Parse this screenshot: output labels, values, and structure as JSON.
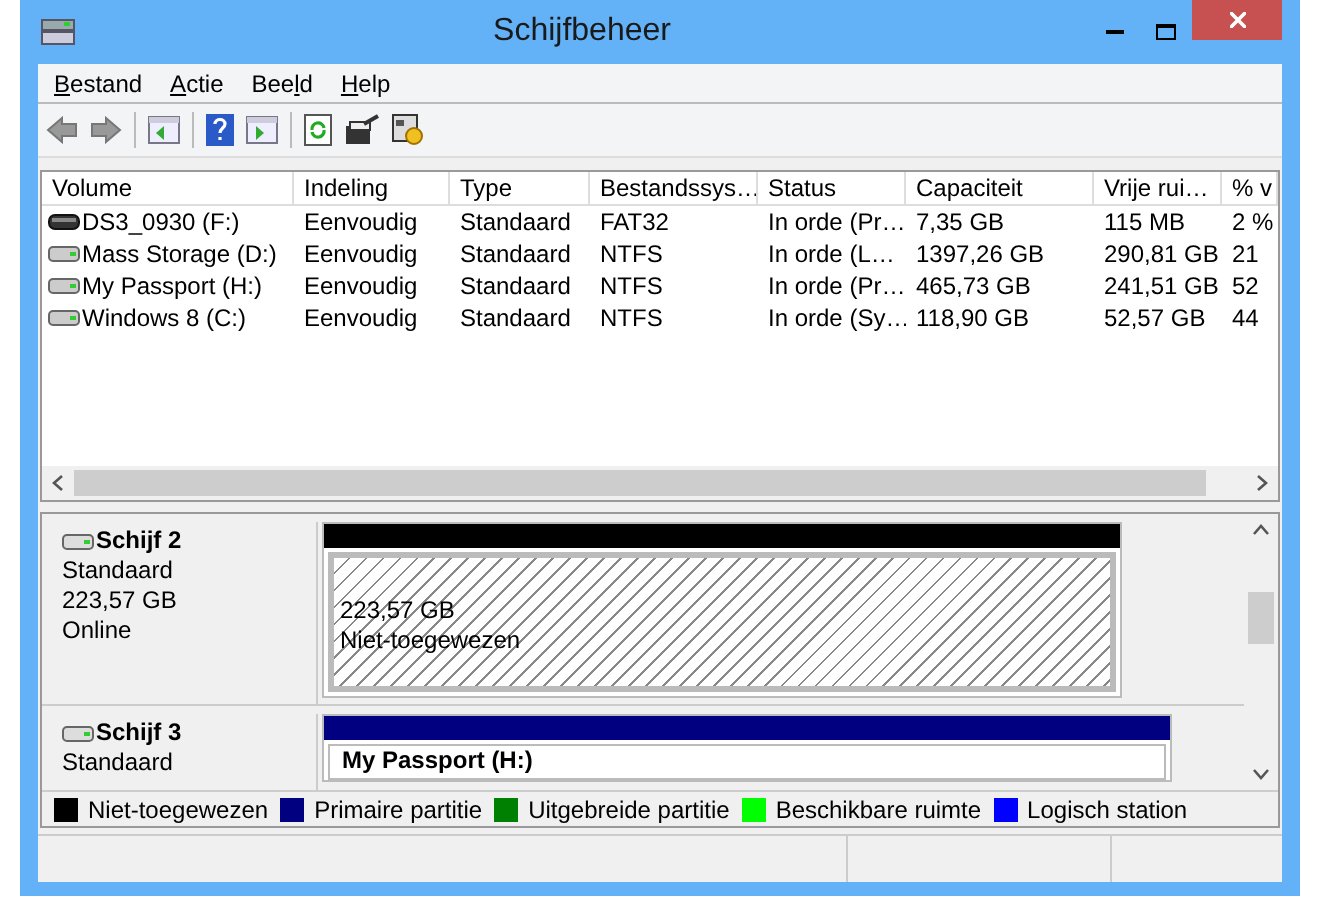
{
  "window": {
    "title": "Schijfbeheer"
  },
  "menu": [
    {
      "key": "B",
      "rest": "estand"
    },
    {
      "key": "A",
      "rest": "ctie"
    },
    {
      "lead": "Bee",
      "key": "l",
      "rest": "d"
    },
    {
      "key": "H",
      "rest": "elp"
    }
  ],
  "table": {
    "columns": [
      "Volume",
      "Indeling",
      "Type",
      "Bestandssys…",
      "Status",
      "Capaciteit",
      "Vrije rui…",
      "% v"
    ],
    "rows": [
      {
        "kind": "removable",
        "cells": [
          "DS3_0930 (F:)",
          "Eenvoudig",
          "Standaard",
          "FAT32",
          "In orde (Pr…",
          "7,35 GB",
          "115 MB",
          "2 %"
        ]
      },
      {
        "kind": "disk",
        "cells": [
          "Mass Storage (D:)",
          "Eenvoudig",
          "Standaard",
          "NTFS",
          "In orde (L…",
          "1397,26 GB",
          "290,81 GB",
          "21"
        ]
      },
      {
        "kind": "disk",
        "cells": [
          "My Passport (H:)",
          "Eenvoudig",
          "Standaard",
          "NTFS",
          "In orde (Pr…",
          "465,73 GB",
          "241,51 GB",
          "52"
        ]
      },
      {
        "kind": "disk",
        "cells": [
          "Windows 8 (C:)",
          "Eenvoudig",
          "Standaard",
          "NTFS",
          "In orde (Sy…",
          "118,90 GB",
          "52,57 GB",
          "44"
        ]
      }
    ]
  },
  "disks": [
    {
      "name": "Schijf 2",
      "lines": [
        "Standaard",
        "223,57 GB",
        "Online"
      ],
      "partition": {
        "kind": "unallocated",
        "color": "#000000",
        "lines": [
          "223,57 GB",
          "Niet-toegewezen"
        ]
      }
    },
    {
      "name": "Schijf 3",
      "lines": [
        "Standaard"
      ],
      "partition": {
        "kind": "primary",
        "color": "#000080",
        "title": "My Passport  (H:)"
      }
    }
  ],
  "legend": [
    {
      "label": "Niet-toegewezen",
      "color": "#000000"
    },
    {
      "label": "Primaire partitie",
      "color": "#000080"
    },
    {
      "label": "Uitgebreide partitie",
      "color": "#008000"
    },
    {
      "label": "Beschikbare ruimte",
      "color": "#00ff00"
    },
    {
      "label": "Logisch station",
      "color": "#0000ff"
    }
  ]
}
